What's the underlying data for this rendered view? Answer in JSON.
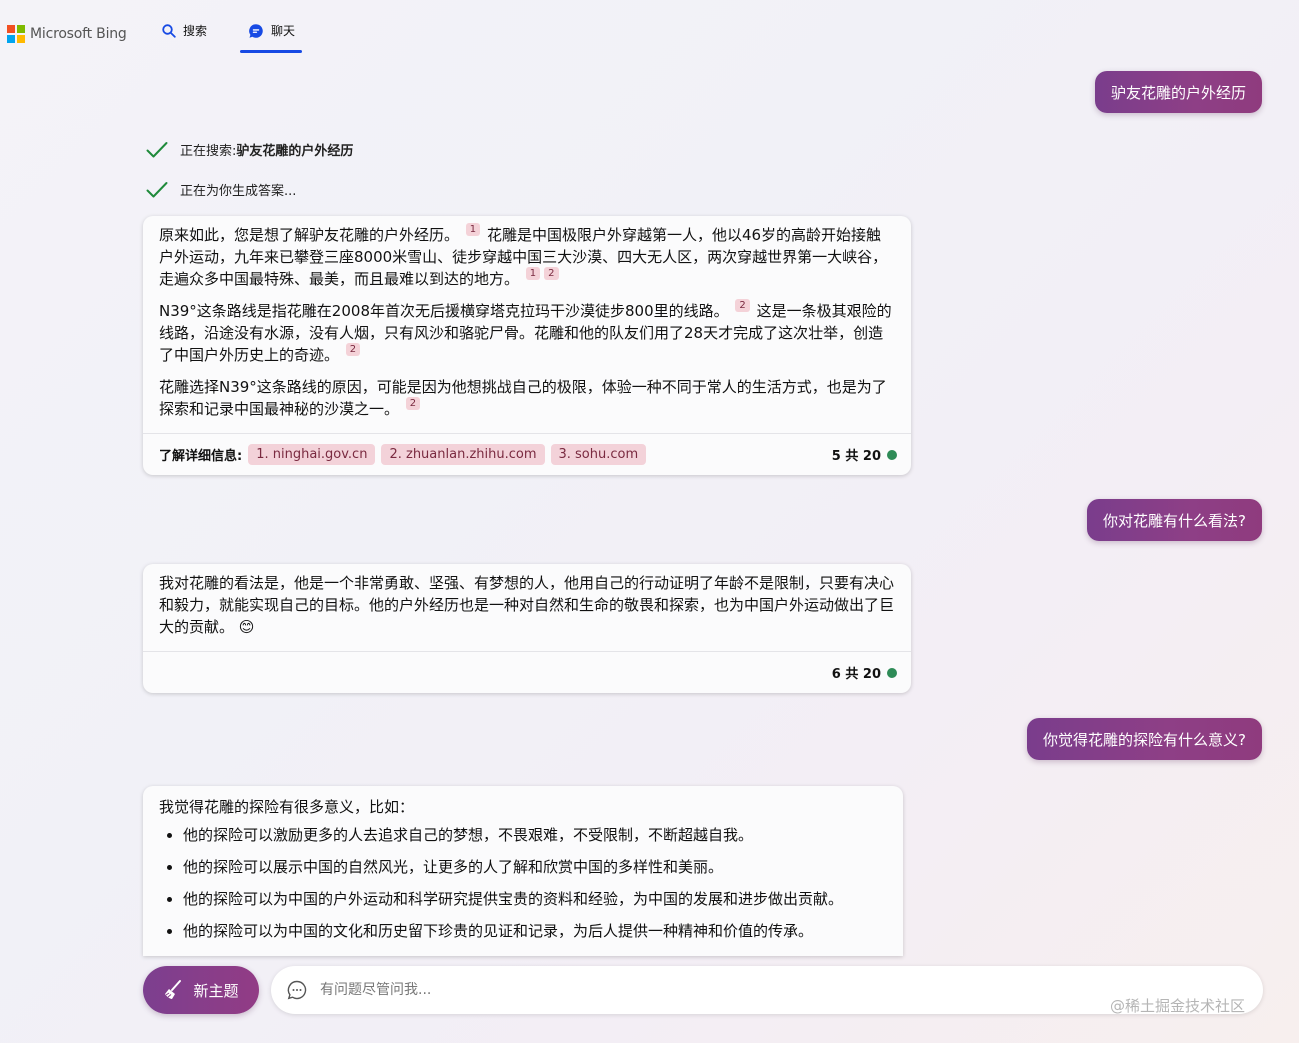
{
  "header": {
    "brand": "Microsoft Bing",
    "logo_colors": [
      "#f25022",
      "#7fba00",
      "#00a4ef",
      "#ffb900"
    ],
    "tabs": [
      {
        "label": "搜索",
        "icon": "search-icon"
      },
      {
        "label": "聊天",
        "icon": "chat-icon",
        "active": true
      }
    ],
    "accent": "#174ae4"
  },
  "conversation": {
    "user1": "驴友花雕的户外经历",
    "status1_prefix": "正在搜索: ",
    "status1_query": "驴友花雕的户外经历",
    "status2": "正在为你生成答案...",
    "bot1": {
      "p1a": "原来如此，您是想了解驴友花雕的户外经历。",
      "p1b": "花雕是中国极限户外穿越第一人，他以46岁的高龄开始接触户外运动，九年来已攀登三座8000米雪山、徒步穿越中国三大沙漠、四大无人区，两次穿越世界第一大峡谷，走遍众多中国最特殊、最美，而且最难以到达的地方。",
      "p2a": "N39°这条路线是指花雕在2008年首次无后援横穿塔克拉玛干沙漠徒步800里的线路。",
      "p2b": "这是一条极其艰险的线路，沿途没有水源，没有人烟，只有风沙和骆驼尸骨。花雕和他的队友们用了28天才完成了这次壮举，创造了中国户外历史上的奇迹。",
      "p3": "花雕选择N39°这条路线的原因，可能是因为他想挑战自己的极限，体验一种不同于常人的生活方式，也是为了探索和记录中国最神秘的沙漠之一。",
      "cites": [
        "1",
        "2"
      ],
      "learn_more": "了解详细信息:",
      "sources": [
        "1. ninghai.gov.cn",
        "2. zhuanlan.zhihu.com",
        "3. sohu.com"
      ],
      "count": "5 共 20"
    },
    "user2": "你对花雕有什么看法?",
    "bot2": {
      "text": "我对花雕的看法是，他是一个非常勇敢、坚强、有梦想的人，他用自己的行动证明了年龄不是限制，只要有决心和毅力，就能实现自己的目标。他的户外经历也是一种对自然和生命的敬畏和探索，也为中国户外运动做出了巨大的贡献。",
      "emoji": "😊",
      "count": "6 共 20"
    },
    "user3": "你觉得花雕的探险有什么意义?",
    "bot3": {
      "intro": "我觉得花雕的探险有很多意义，比如：",
      "items": [
        "他的探险可以激励更多的人去追求自己的梦想，不畏艰难，不受限制，不断超越自我。",
        "他的探险可以展示中国的自然风光，让更多的人了解和欣赏中国的多样性和美丽。",
        "他的探险可以为中国的户外运动和科学研究提供宝贵的资料和经验，为中国的发展和进步做出贡献。",
        "他的探险可以为中国的文化和历史留下珍贵的见证和记录，为后人提供一种精神和价值的传承。"
      ]
    }
  },
  "composer": {
    "new_topic": "新主题",
    "placeholder": "有问题尽管问我..."
  },
  "watermark": "@稀土掘金技术社区"
}
